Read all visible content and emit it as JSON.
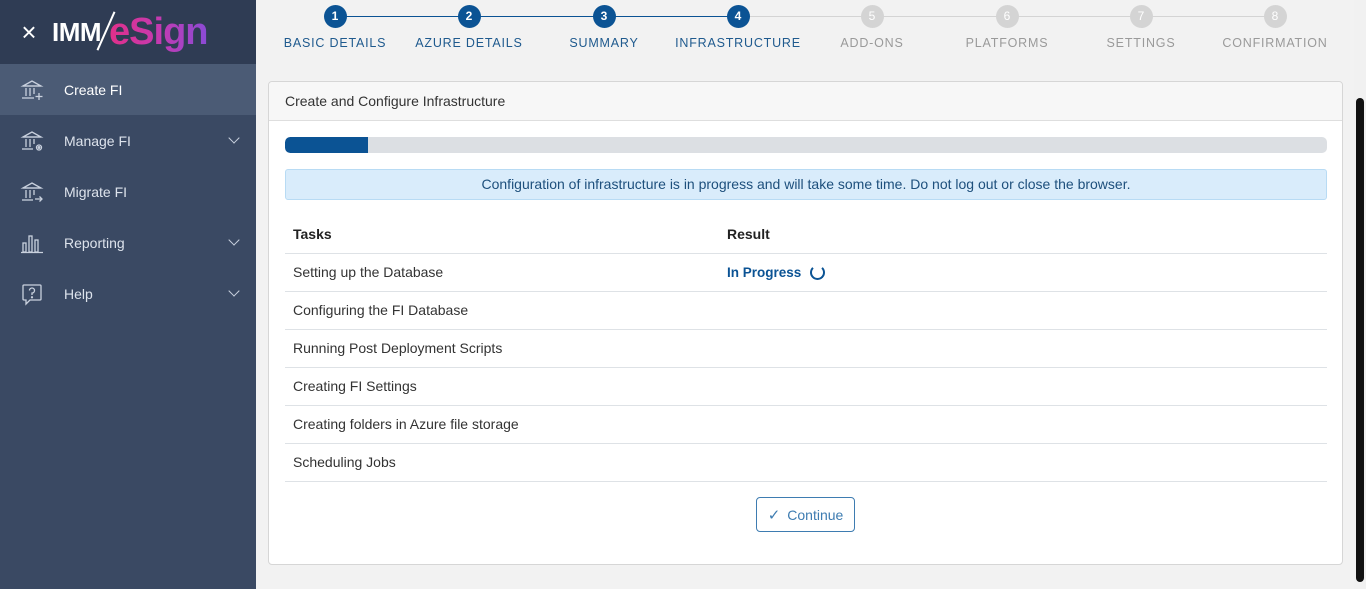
{
  "app": {
    "logo_left": "IMM",
    "logo_right": "eSign"
  },
  "sidebar": {
    "items": [
      {
        "label": "Create FI",
        "icon": "bank-plus-icon",
        "active": true,
        "expandable": false
      },
      {
        "label": "Manage FI",
        "icon": "bank-gear-icon",
        "active": false,
        "expandable": true
      },
      {
        "label": "Migrate FI",
        "icon": "bank-arrow-icon",
        "active": false,
        "expandable": false
      },
      {
        "label": "Reporting",
        "icon": "bar-chart-icon",
        "active": false,
        "expandable": true
      },
      {
        "label": "Help",
        "icon": "help-question-icon",
        "active": false,
        "expandable": true
      }
    ]
  },
  "stepper": {
    "steps": [
      {
        "number": "1",
        "label": "BASIC DETAILS",
        "state": "done"
      },
      {
        "number": "2",
        "label": "AZURE DETAILS",
        "state": "done"
      },
      {
        "number": "3",
        "label": "SUMMARY",
        "state": "done"
      },
      {
        "number": "4",
        "label": "INFRASTRUCTURE",
        "state": "done"
      },
      {
        "number": "5",
        "label": "ADD-ONS",
        "state": "todo"
      },
      {
        "number": "6",
        "label": "PLATFORMS",
        "state": "todo"
      },
      {
        "number": "7",
        "label": "SETTINGS",
        "state": "todo"
      },
      {
        "number": "8",
        "label": "CONFIRMATION",
        "state": "todo"
      }
    ]
  },
  "card": {
    "title": "Create and Configure Infrastructure",
    "progress_fraction": 0.08,
    "alert": "Configuration of infrastructure is in progress and will take some time. Do not log out or close the browser.",
    "table": {
      "headers": [
        "Tasks",
        "Result"
      ],
      "rows": [
        {
          "task": "Setting up the Database",
          "result": "In Progress"
        },
        {
          "task": "Configuring the FI Database",
          "result": ""
        },
        {
          "task": "Running Post Deployment Scripts",
          "result": ""
        },
        {
          "task": "Creating FI Settings",
          "result": ""
        },
        {
          "task": "Creating folders in Azure file storage",
          "result": ""
        },
        {
          "task": "Scheduling Jobs",
          "result": ""
        }
      ]
    },
    "continue_label": "Continue"
  },
  "colors": {
    "sidebar_bg": "#3a4963",
    "accent": "#0b5394",
    "alert_bg": "#d9ecfb"
  }
}
